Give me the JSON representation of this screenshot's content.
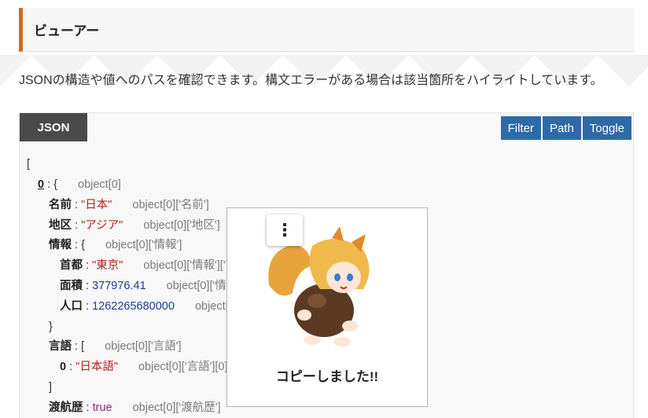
{
  "header": {
    "title": "ビューアー"
  },
  "description": "JSONの構造や値へのパスを確認できます。構文エラーがある場合は該当箇所をハイライトしています。",
  "viewer": {
    "tab_label": "JSON",
    "buttons": {
      "filter": "Filter",
      "path": "Path",
      "toggle": "Toggle"
    },
    "open_bracket": "[",
    "lines": [
      {
        "indent": 1,
        "key": "0",
        "sep": " : ",
        "value": "{",
        "vtype": "punc",
        "path": "object[0]",
        "index": true
      },
      {
        "indent": 2,
        "key": "名前",
        "sep": " : ",
        "value": "\"日本\"",
        "vtype": "str",
        "path": "object[0]['名前']"
      },
      {
        "indent": 2,
        "key": "地区",
        "sep": " : ",
        "value": "\"アジア\"",
        "vtype": "str",
        "path": "object[0]['地区']"
      },
      {
        "indent": 2,
        "key": "情報",
        "sep": " : ",
        "value": "{",
        "vtype": "punc",
        "path": "object[0]['情報']"
      },
      {
        "indent": 3,
        "key": "首都",
        "sep": " : ",
        "value": "\"東京\"",
        "vtype": "str",
        "path": "object[0]['情報']['首都']"
      },
      {
        "indent": 3,
        "key": "面積",
        "sep": " : ",
        "value": "377976.41",
        "vtype": "num",
        "path": "object[0]['情報']['面積']"
      },
      {
        "indent": 3,
        "key": "人口",
        "sep": " : ",
        "value": "1262265680000",
        "vtype": "num",
        "path": "object[0]['情報']['人口']"
      },
      {
        "indent": 2,
        "key": "",
        "sep": "",
        "value": "}",
        "vtype": "punc",
        "path": ""
      },
      {
        "indent": 2,
        "key": "言語",
        "sep": " : ",
        "value": "[",
        "vtype": "punc",
        "path": "object[0]['言語']"
      },
      {
        "indent": 3,
        "key": "0",
        "sep": " : ",
        "value": "\"日本語\"",
        "vtype": "str",
        "path": "object[0]['言語'][0]"
      },
      {
        "indent": 2,
        "key": "",
        "sep": "",
        "value": "]",
        "vtype": "punc",
        "path": ""
      },
      {
        "indent": 2,
        "key": "渡航歴",
        "sep": " : ",
        "value": "true",
        "vtype": "bool",
        "path": "object[0]['渡航歴']"
      }
    ]
  },
  "popup": {
    "menu_icon": "vertical-dots-icon",
    "menu_glyph": "⋮",
    "message": "コピーしました!!"
  }
}
